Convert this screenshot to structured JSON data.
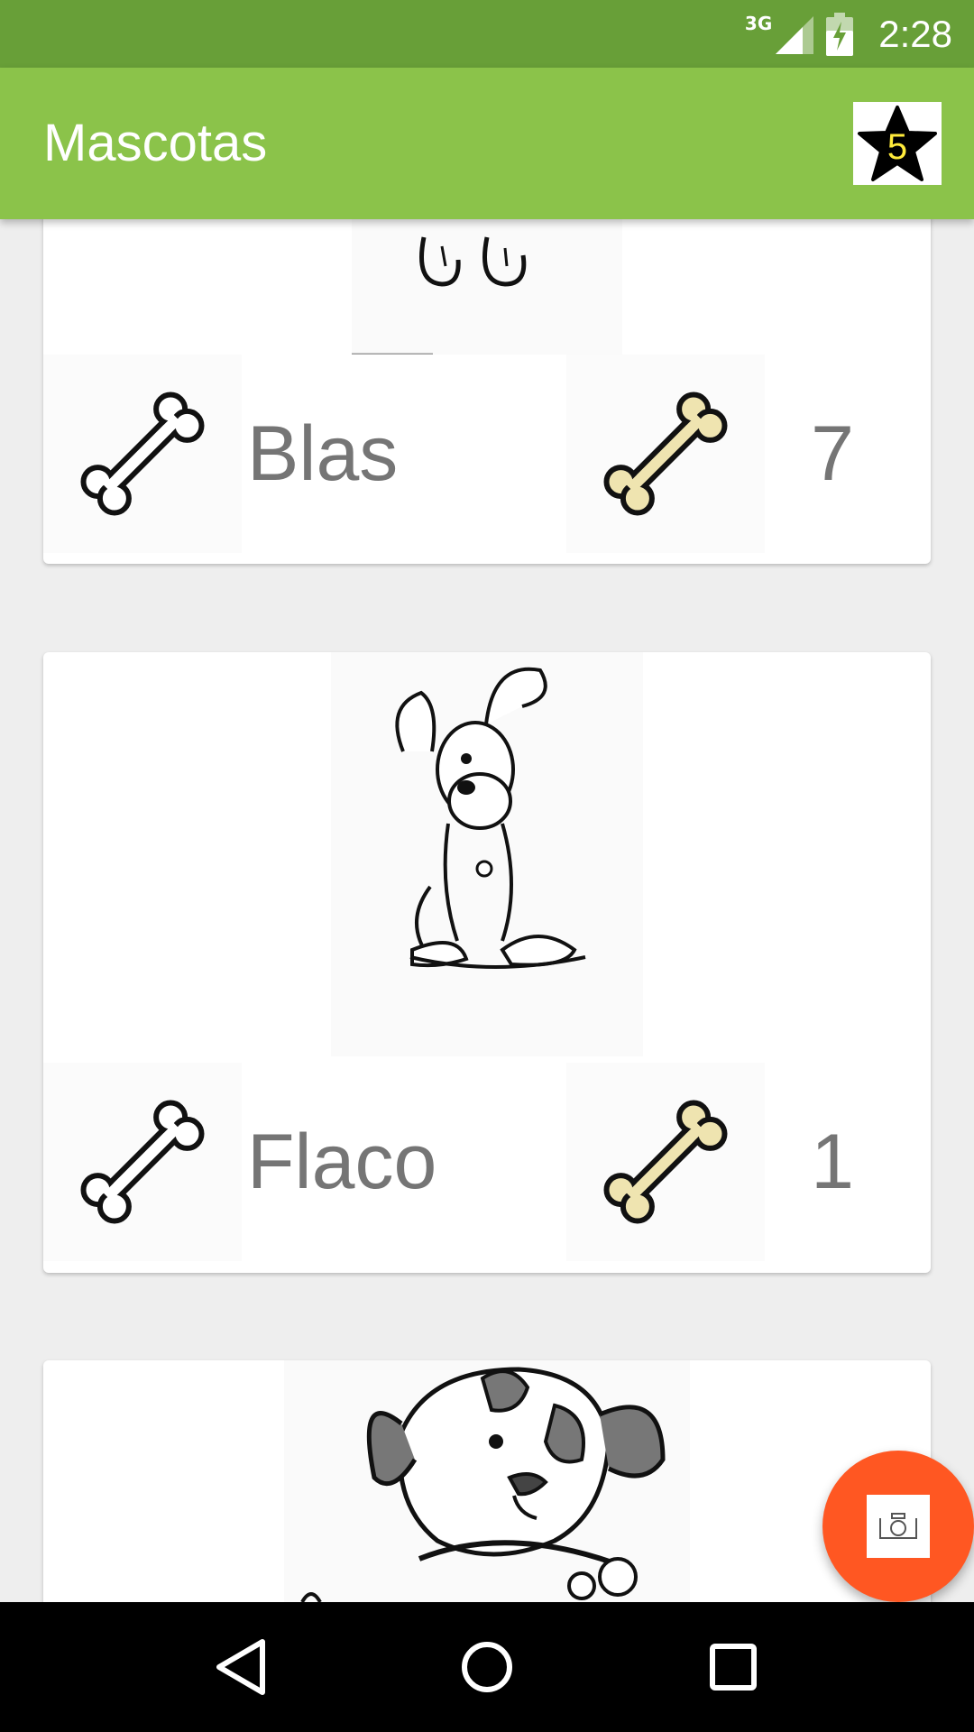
{
  "status_bar": {
    "network": "3G",
    "time": "2:28"
  },
  "app_bar": {
    "title": "Mascotas",
    "favorites_count": "5"
  },
  "pets": [
    {
      "name": "Blas",
      "likes": "7"
    },
    {
      "name": "Flaco",
      "likes": "1"
    }
  ],
  "icons": {
    "like": "bone-outline-icon",
    "likes_count": "bone-filled-icon",
    "favorites": "star-icon",
    "fab": "camera-icon"
  },
  "colors": {
    "status_bar": "#689f38",
    "app_bar": "#8bc34a",
    "fab": "#ff5722",
    "bone_fill": "#efe4b0",
    "star_count": "#ffeb3b"
  }
}
